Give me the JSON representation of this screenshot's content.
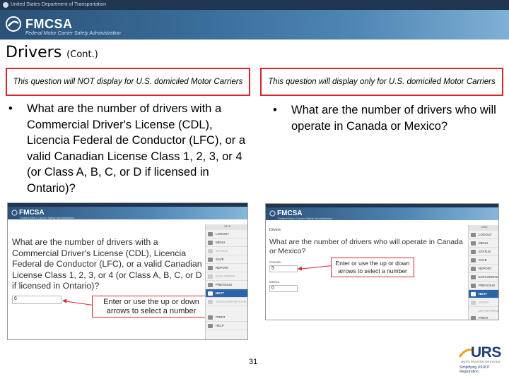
{
  "header": {
    "dot_text": "United States Department of Transportation",
    "brand": "FMCSA",
    "brand_subline": "Federal Motor Carrier Safety Administration"
  },
  "title": {
    "main": "Drivers",
    "suffix": "(Cont.)"
  },
  "notes": {
    "left": "This question will NOT display for U.S. domiciled Motor Carriers",
    "right": "This question will display only for U.S. domiciled Motor Carriers"
  },
  "bullets": {
    "left": "What are the number of drivers with a Commercial Driver's License (CDL), Licencia Federal de Conductor (LFC), or a valid Canadian License Class 1, 2, 3, or 4 (or Class A, B, C, or D if licensed in Ontario)?",
    "right": "What are the number of drivers who will operate in Canada or Mexico?"
  },
  "screenshot_left": {
    "brand": "FMCSA",
    "subline": "Federal Motor Carrier Safety Administration",
    "question": "What are the number of drivers with a Commercial Driver's License (CDL), Licencia Federal de Conductor (LFC), or a valid Canadian License Class 1, 2, 3, or 4 (or Class A, B, C, or D if licensed in Ontario)?",
    "input_value": "6",
    "callout": "Enter or use the up or down arrows to select a number",
    "menu_id": "2476",
    "menu": [
      {
        "label": "LOGOUT",
        "state": "normal"
      },
      {
        "label": "MENU",
        "state": "normal"
      },
      {
        "label": "STATUS",
        "state": "dim"
      },
      {
        "label": "SAVE",
        "state": "normal"
      },
      {
        "label": "REPORT",
        "state": "normal"
      },
      {
        "label": "EXPLORERS",
        "state": "dim"
      },
      {
        "label": "PREVIOUS",
        "state": "normal"
      },
      {
        "label": "NEXT",
        "state": "highlight"
      },
      {
        "label": "SHOW DEFINITIONS",
        "state": "dim"
      },
      {
        "label": "PRINT",
        "state": "normal"
      },
      {
        "label": "HELP",
        "state": "normal"
      }
    ]
  },
  "screenshot_right": {
    "brand": "FMCSA",
    "subline": "Federal Motor Carrier Safety Administration",
    "section": "Drivers",
    "question": "What are the number of drivers who will operate in Canada or Mexico?",
    "canada_label": "Canada",
    "canada_value": "5",
    "mexico_label": "Mexico",
    "mexico_value": "0",
    "callout": "Enter or use the up or down arrows to select a number",
    "menu_id": "2490",
    "menu": [
      {
        "label": "LOGOUT",
        "state": "normal"
      },
      {
        "label": "MENU",
        "state": "normal"
      },
      {
        "label": "STATUS",
        "state": "normal"
      },
      {
        "label": "SAVE",
        "state": "normal"
      },
      {
        "label": "REPORT",
        "state": "normal"
      },
      {
        "label": "EXPLORERS",
        "state": "normal"
      },
      {
        "label": "PREVIOUS",
        "state": "normal"
      },
      {
        "label": "NEXT",
        "state": "highlight"
      },
      {
        "label": "SHOW DEFINITIONS",
        "state": "dim"
      },
      {
        "label": "PRINT",
        "state": "normal"
      },
      {
        "label": "HELP",
        "state": "normal"
      }
    ]
  },
  "footer": {
    "page_number": "31",
    "urs_brand": "URS",
    "urs_tagline": "UNITED REGISTRATION SYSTEM",
    "urs_tagline2": "Simplifying USDOT Registration"
  },
  "colors": {
    "accent_red": "#d9232e",
    "banner_blue": "#2a5178",
    "urs_blue": "#1f3f78",
    "next_highlight": "#2b65a8"
  }
}
